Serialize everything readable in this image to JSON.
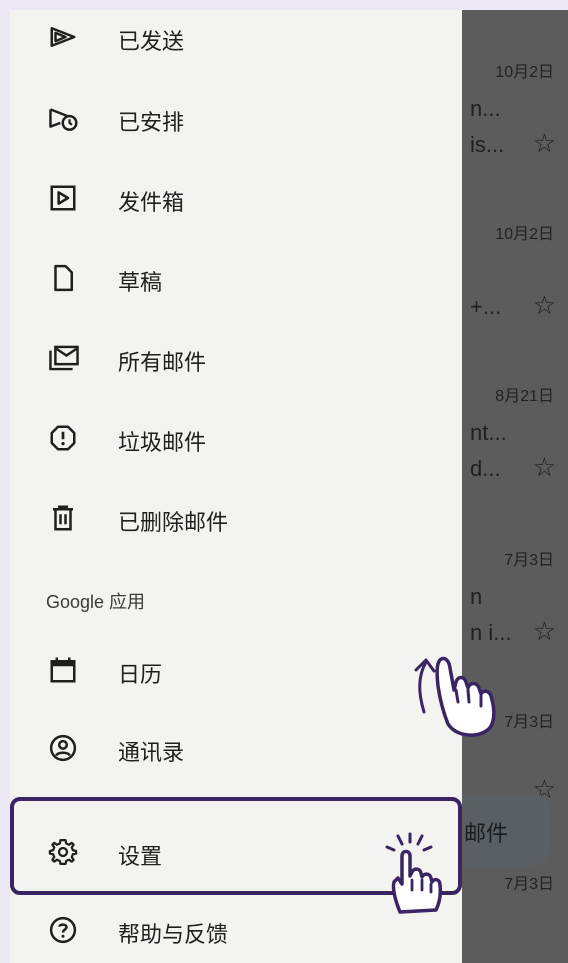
{
  "drawer": {
    "items": [
      {
        "id": "sent",
        "label": "已发送",
        "icon": "send-icon"
      },
      {
        "id": "scheduled",
        "label": "已安排",
        "icon": "scheduled-send-icon"
      },
      {
        "id": "outbox",
        "label": "发件箱",
        "icon": "outbox-icon"
      },
      {
        "id": "drafts",
        "label": "草稿",
        "icon": "draft-icon"
      },
      {
        "id": "all-mail",
        "label": "所有邮件",
        "icon": "all-mail-icon"
      },
      {
        "id": "spam",
        "label": "垃圾邮件",
        "icon": "spam-icon"
      },
      {
        "id": "trash",
        "label": "已删除邮件",
        "icon": "trash-icon"
      }
    ],
    "google_apps_header": "Google 应用",
    "apps": [
      {
        "id": "calendar",
        "label": "日历",
        "icon": "calendar-icon"
      },
      {
        "id": "contacts",
        "label": "通讯录",
        "icon": "contacts-icon"
      }
    ],
    "settings_label": "设置",
    "help_label": "帮助与反馈"
  },
  "inbox": {
    "rows": [
      {
        "date": "10月2日",
        "line1": "n...",
        "line2": "is..."
      },
      {
        "date": "10月2日",
        "line1": "",
        "line2": "+..."
      },
      {
        "date": "8月21日",
        "line1": "nt...",
        "line2": "d..."
      },
      {
        "date": "7月3日",
        "line1": "n",
        "line2": "n i..."
      },
      {
        "date": "7月3日",
        "line1": "",
        "line2": ""
      },
      {
        "date": "7月3日",
        "line1": "",
        "line2": ""
      }
    ],
    "compose_label": "邮件"
  },
  "colors": {
    "highlight_border": "#3a2463",
    "gesture_purple": "#3a2463",
    "drawer_bg": "#f3f3f0",
    "scrim": "#5c5c5c"
  }
}
